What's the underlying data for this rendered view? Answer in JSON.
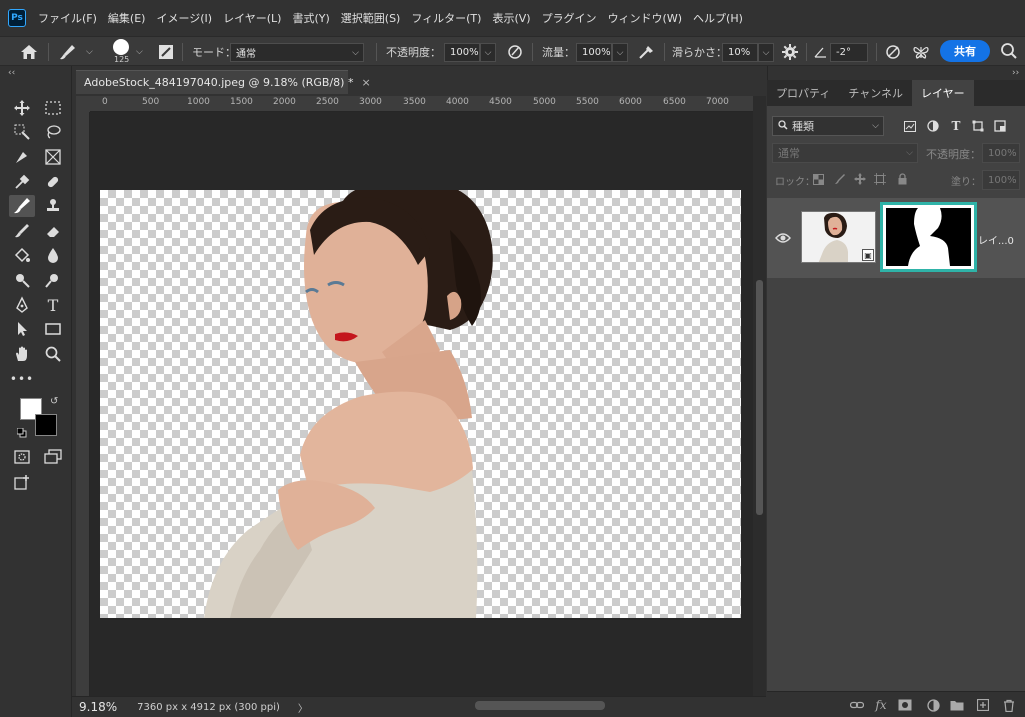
{
  "app": {
    "logo": "Ps",
    "accent": "#31a8ff"
  },
  "menu": [
    "ファイル(F)",
    "編集(E)",
    "イメージ(I)",
    "レイヤー(L)",
    "書式(Y)",
    "選択範囲(S)",
    "フィルター(T)",
    "表示(V)",
    "プラグイン",
    "ウィンドウ(W)",
    "ヘルプ(H)"
  ],
  "options": {
    "brush_size": "125",
    "mode_label": "モード：",
    "mode_value": "通常",
    "opacity_label": "不透明度：",
    "opacity_value": "100%",
    "flow_label": "流量：",
    "flow_value": "100%",
    "smoothing_label": "滑らかさ：",
    "smoothing_value": "10%",
    "angle_value": "-2°",
    "share_label": "共有",
    "share_color": "#1473e6"
  },
  "document": {
    "tab_title": "AdobeStock_484197040.jpeg @ 9.18% (RGB/8) *",
    "close_glyph": "×",
    "ruler_labels": [
      "0",
      "500",
      "1000",
      "1500",
      "2000",
      "2500",
      "3000",
      "3500",
      "4000",
      "4500",
      "5000",
      "5500",
      "6000",
      "6500",
      "7000"
    ]
  },
  "status": {
    "zoom": "9.18%",
    "dimensions": "7360 px x 4912 px (300 ppi)",
    "arrow": "〉"
  },
  "panel": {
    "tabs": [
      "プロパティ",
      "チャンネル",
      "レイヤー"
    ],
    "active_tab": "レイヤー",
    "filter_value": "種類",
    "blend_value": "通常",
    "opacity_label": "不透明度：",
    "opacity_value": "100%",
    "lock_label": "ロック：",
    "fill_label": "塗り：",
    "fill_value": "100%",
    "layer_name": "レイ...0",
    "highlight_color": "#2fb3a8"
  },
  "colors": {
    "foreground": "#ffffff",
    "background": "#000000"
  }
}
